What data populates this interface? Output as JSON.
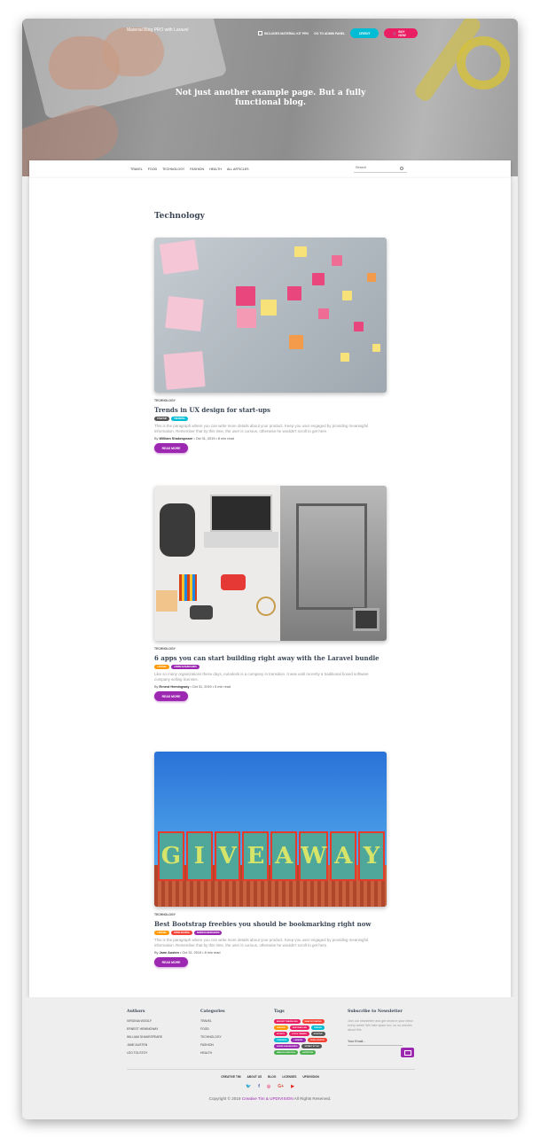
{
  "hero": {
    "brand": "Material Blog PRO with Laravel",
    "nav_material": "INCLUDES MATERIAL KIT PRO",
    "nav_admin": "GO TO ADMIN PANEL",
    "credit": "CREDIT",
    "buy": "BUY NOW",
    "title": "Not just another example page. But a fully functional blog."
  },
  "navbar": {
    "links": [
      "TRAVEL",
      "FOOD",
      "TECHNOLOGY",
      "FASHION",
      "HEALTH",
      "ALL ARTICLES"
    ],
    "search_placeholder": "Search"
  },
  "page": {
    "title": "Technology"
  },
  "posts": [
    {
      "category": "TECHNOLOGY",
      "title": "Trends in UX design for start-ups",
      "tags": [
        {
          "label": "STARTUP",
          "color": "#555555"
        },
        {
          "label": "TRENDING",
          "color": "#00bcd4"
        }
      ],
      "excerpt": "This is the paragraph where you can write more details about your product. Keep you user engaged by providing meaningful information. Remember that by this time, the user is curious, otherwise he wouldn't scroll to get here.",
      "by": "By",
      "author": "William Shakespeare",
      "meta": "• Oct 31, 2019 • 8 min read",
      "button": "READ MORE"
    },
    {
      "category": "TECHNOLOGY",
      "title": "6 apps you can start building right away with the Laravel bundle",
      "tags": [
        {
          "label": "LARAVEL",
          "color": "#ff9800"
        },
        {
          "label": "ADMIN DASHBOARDS",
          "color": "#9c27b0"
        }
      ],
      "excerpt": "Like so many organizations these days, Autodesk is a company in transition. It was until recently a traditional boxed software company selling licenses.",
      "by": "By",
      "author": "Ernest Hemingway",
      "meta": "• Oct 31, 2019 • 5 min read",
      "button": "READ MORE"
    },
    {
      "category": "TECHNOLOGY",
      "title": "Best Bootstrap freebies you should be bookmarking right now",
      "tags": [
        {
          "label": "LARAVEL",
          "color": "#ff9800"
        },
        {
          "label": "OPEN SOURCE",
          "color": "#f44336"
        },
        {
          "label": "ADMIN DASHBOARDS",
          "color": "#9c27b0"
        }
      ],
      "excerpt": "This is the paragraph where you can write more details about your product. Keep you user engaged by providing meaningful information. Remember that by this time, the user is curious, otherwise he wouldn't scroll to get here.",
      "by": "By",
      "author": "Jane Austen",
      "meta": "• Oct 31, 2019 • 8 min read",
      "button": "READ MORE"
    }
  ],
  "giveaway_letters": [
    "G",
    "I",
    "V",
    "E",
    "A",
    "W",
    "A",
    "Y"
  ],
  "footer": {
    "authors_title": "Authors",
    "authors": [
      "VIRGINIA WOOLF",
      "ERNEST HEMINGWAY",
      "WILLIAM SHAKESPEARE",
      "JANE AUSTEN",
      "LEO TOLSTOY"
    ],
    "categories_title": "Categories",
    "categories": [
      "TRAVEL",
      "FOOD",
      "TECHNOLOGY",
      "FASHION",
      "HEALTH"
    ],
    "tags_title": "Tags",
    "tags": [
      {
        "label": "BUDGET TRAVELLING",
        "color": "#e91e63"
      },
      {
        "label": "HEALTHY EATING",
        "color": "#f44336"
      },
      {
        "label": "FASHION",
        "color": "#ff9800"
      },
      {
        "label": "DESTINATIONS",
        "color": "#e91e63"
      },
      {
        "label": "TRENDS",
        "color": "#00bcd4"
      },
      {
        "label": "SPORTS",
        "color": "#e91e63"
      },
      {
        "label": "STYLE TRENDS",
        "color": "#e91e63"
      },
      {
        "label": "STARTUP",
        "color": "#555555"
      },
      {
        "label": "TRENDING",
        "color": "#00bcd4"
      },
      {
        "label": "LARAVEL",
        "color": "#9c27b0"
      },
      {
        "label": "OPEN SOURCE",
        "color": "#f44336"
      },
      {
        "label": "ADMIN DASHBOARDS",
        "color": "#9c27b0"
      },
      {
        "label": "STREET STYLE",
        "color": "#555555"
      },
      {
        "label": "HEALTH LIFESTYLE",
        "color": "#4caf50"
      },
      {
        "label": "NUTRITION",
        "color": "#4caf50"
      }
    ],
    "newsletter_title": "Subscribe to Newsletter",
    "newsletter_text": "Join our newsletter and get news in your inbox every week! We hate spam too, so no worries about this.",
    "email_placeholder": "Your Email...",
    "links": [
      "CREATIVE TIM",
      "ABOUT US",
      "BLOG",
      "LICENSES",
      "UPDIVISION"
    ],
    "copyright_prefix": "Copyright © 2019",
    "copyright_links": "Creative Tim & UPDIVISION",
    "copyright_suffix": "All Rights Reserved."
  },
  "social": [
    {
      "icon": "twitter-icon",
      "glyph": "🐦",
      "color": "#55acee"
    },
    {
      "icon": "facebook-icon",
      "glyph": "f",
      "color": "#3b5998"
    },
    {
      "icon": "dribbble-icon",
      "glyph": "◎",
      "color": "#ea4c89"
    },
    {
      "icon": "google-plus-icon",
      "glyph": "G+",
      "color": "#dd4b39"
    },
    {
      "icon": "youtube-icon",
      "glyph": "▶",
      "color": "#e52d27"
    }
  ]
}
